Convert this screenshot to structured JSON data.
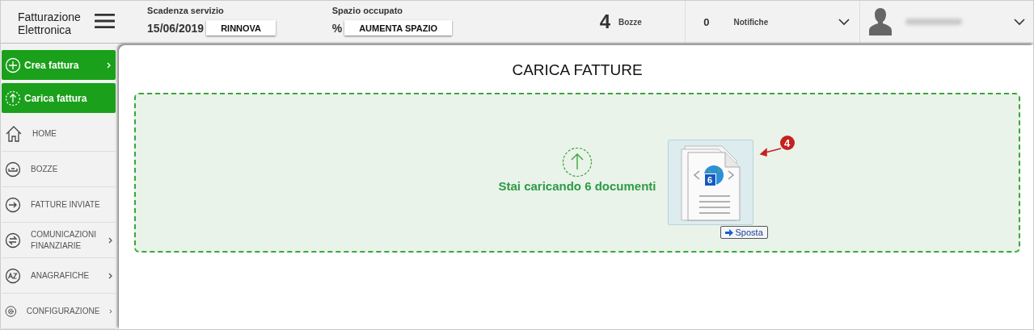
{
  "header": {
    "logo": [
      "Fatturazione",
      "Elettronica"
    ],
    "service": {
      "label": "Scadenza servizio",
      "value": "15/06/2019",
      "button": "RINNOVA"
    },
    "space": {
      "label": "Spazio occupato",
      "value": "%",
      "button": "AUMENTA SPAZIO"
    },
    "drafts": {
      "count": "4",
      "label": "Bozze"
    },
    "notifications": {
      "count": "0",
      "label": "Notifiche"
    }
  },
  "sidebar": {
    "actions": [
      {
        "label": "Crea fattura",
        "kind": "create",
        "arrow": true
      },
      {
        "label": "Carica fattura",
        "kind": "upload",
        "arrow": false
      }
    ],
    "items": [
      {
        "label": "HOME",
        "kind": "home",
        "arrow": false
      },
      {
        "label": "BOZZE",
        "kind": "drafts",
        "arrow": false
      },
      {
        "label": "FATTURE INVIATE",
        "kind": "sent",
        "arrow": false
      },
      {
        "label": "COMUNICAZIONI FINANZIARIE",
        "kind": "exchange",
        "arrow": true
      },
      {
        "label": "ANAGRAFICHE",
        "kind": "az",
        "arrow": true
      },
      {
        "label": "CONFIGURAZIONE",
        "kind": "gear",
        "arrow": true
      }
    ]
  },
  "main": {
    "title": "CARICA FATTURE",
    "dropzone": {
      "message": "Stai caricando 6 documenti",
      "drag": {
        "count": "6",
        "action": "Sposta"
      },
      "callout": "4"
    }
  }
}
